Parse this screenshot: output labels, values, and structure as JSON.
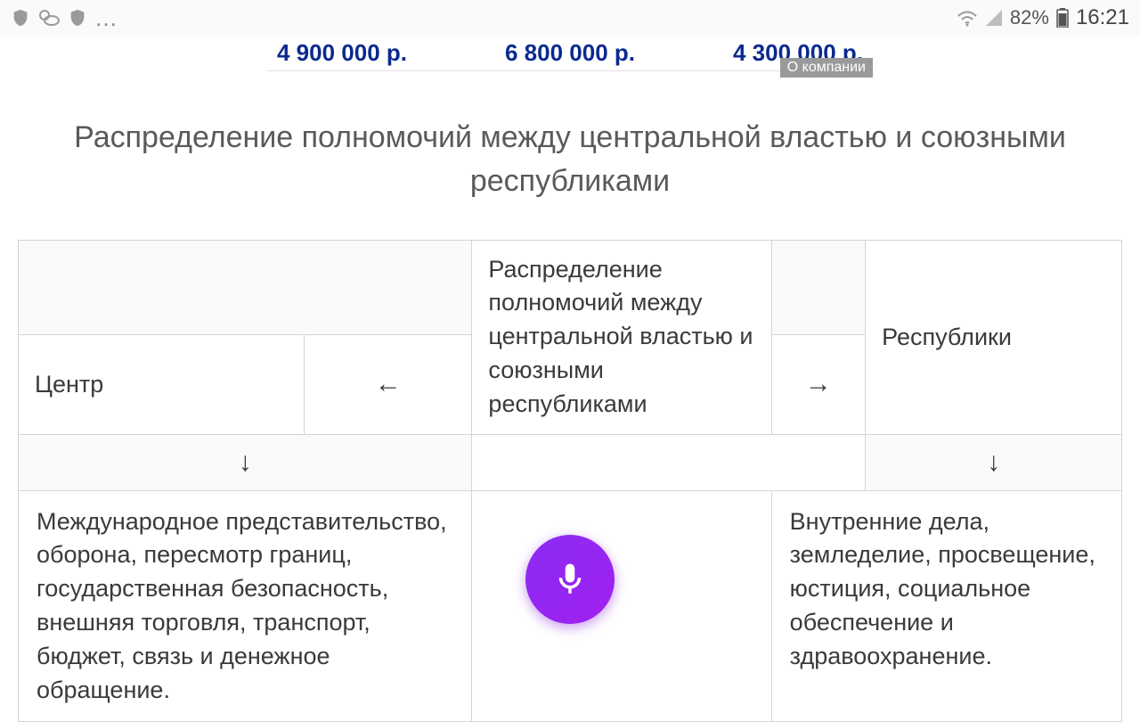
{
  "status": {
    "battery_pct": "82%",
    "time": "16:21"
  },
  "ad": {
    "prices": [
      "4 900 000 р.",
      "6 800 000 р.",
      "4 300 000 р."
    ],
    "about": "О компании"
  },
  "heading": "Распределение полномочий между центральной властью и союзными республиками",
  "table": {
    "center_label": "Центр",
    "left_arrow": "←",
    "center_title": "Распределение полномочий между центральной властью и союзными республиками",
    "right_arrow": "→",
    "republics_label": "Республики",
    "down_arrow": "↓",
    "center_body": "Международное представительство, оборона, пересмотр границ, государственная безопасность, внешняя торговля, транспорт, бюджет, связь и денежное обращение.",
    "republics_body": "Внутренние дела, земледелие, просвещение, юстиция, социальное обеспечение и здравоохранение."
  }
}
